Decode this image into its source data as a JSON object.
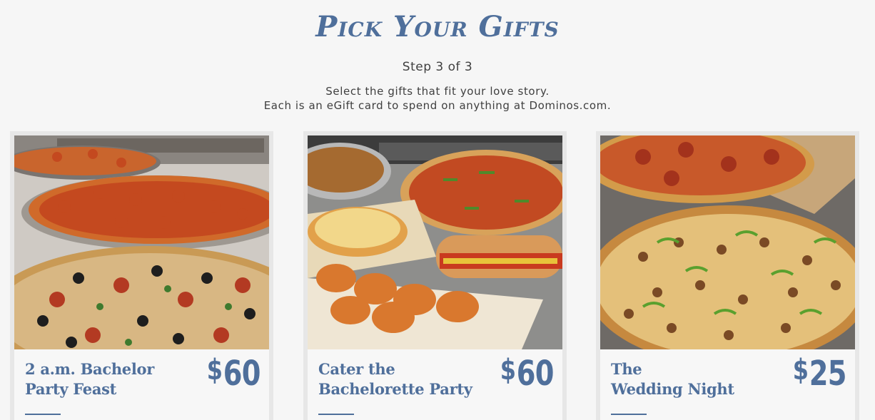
{
  "header": {
    "title": "Pick Your Gifts",
    "step": "Step 3 of 3",
    "desc_line1": "Select the gifts that fit your love story.",
    "desc_line2": "Each is an eGift card to spend on anything at Dominos.com."
  },
  "colors": {
    "accent": "#4f6f9b",
    "background": "#f6f6f6",
    "card_frame": "#e7e7e7"
  },
  "gifts": [
    {
      "name_line1": "2 a.m. Bachelor",
      "name_line2": "Party Feast",
      "currency": "$",
      "price": "60",
      "image": "pizzas-pepperoni-and-veggie-photo"
    },
    {
      "name_line1": "Cater the",
      "name_line2": "Bachelorette Party",
      "currency": "$",
      "price": "60",
      "image": "pizza-wings-sandwich-pasta-photo"
    },
    {
      "name_line1": "The",
      "name_line2": "Wedding Night",
      "currency": "$",
      "price": "25",
      "image": "pepperoni-and-sausage-pepper-pizza-photo"
    }
  ]
}
